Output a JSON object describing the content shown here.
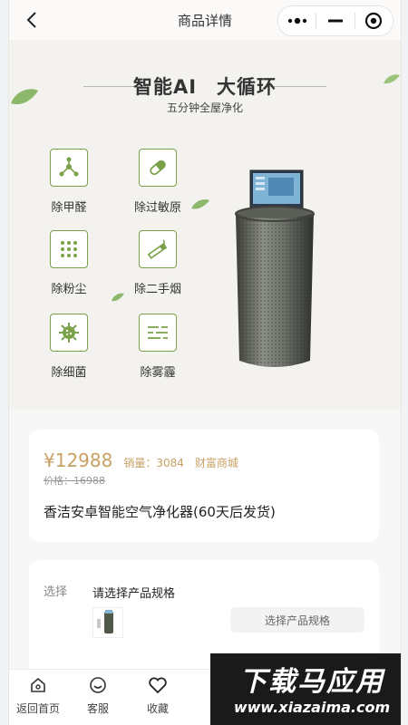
{
  "header": {
    "title": "商品详情",
    "back_icon": "chevron-left-icon",
    "menu_icons": [
      "more-dots-icon",
      "minimize-icon",
      "close-target-icon"
    ]
  },
  "hero": {
    "title": "智能AI　大循环",
    "subtitle": "五分钟全屋净化",
    "features": [
      {
        "label": "除甲醛",
        "icon": "molecule-icon"
      },
      {
        "label": "除过敏原",
        "icon": "capsule-icon"
      },
      {
        "label": "除粉尘",
        "icon": "dots-grid-icon"
      },
      {
        "label": "除二手烟",
        "icon": "cigarette-icon"
      },
      {
        "label": "除细菌",
        "icon": "bacteria-icon"
      },
      {
        "label": "除雾霾",
        "icon": "haze-lines-icon"
      }
    ]
  },
  "price_card": {
    "price": "¥12988",
    "sales": "销量：3084",
    "shop": "财富商城",
    "original_price": "价格：16988",
    "product_name": "香洁安卓智能空气净化器(60天后发货)"
  },
  "spec_card": {
    "label": "选择",
    "prompt": "请选择产品规格",
    "button": "选择产品规格"
  },
  "tabbar": {
    "items": [
      {
        "label": "返回首页",
        "icon": "home-icon"
      },
      {
        "label": "客服",
        "icon": "service-smile-icon"
      },
      {
        "label": "收藏",
        "icon": "heart-icon"
      }
    ]
  },
  "watermark": {
    "top": "下载马应用",
    "bottom": "www.xiazaima.com"
  },
  "colors": {
    "accent_gold": "#c9a064",
    "icon_green": "#7aa14a"
  }
}
